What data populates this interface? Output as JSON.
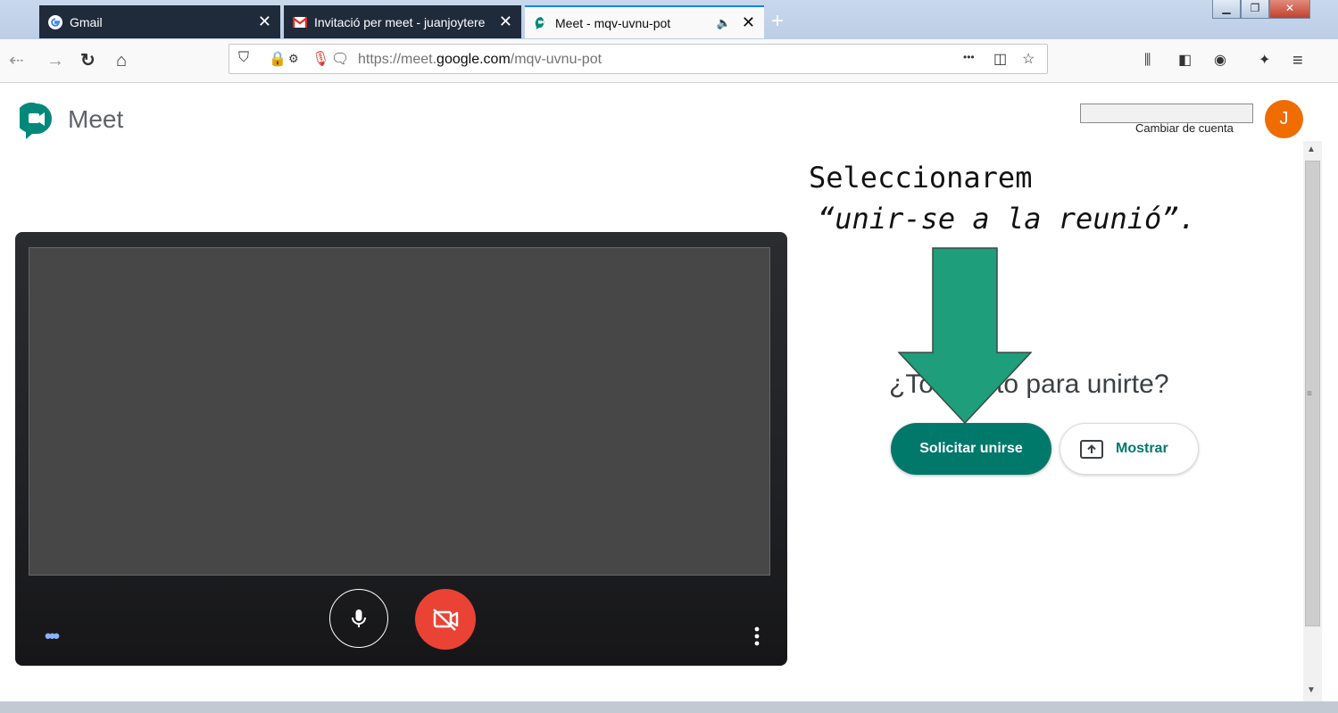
{
  "browser": {
    "tabs": [
      {
        "title": "Gmail",
        "close": "✕"
      },
      {
        "title": "Invitació per meet - juanjoytere",
        "close": "✕"
      },
      {
        "title": "Meet - mqv-uvnu-pot",
        "close": "✕",
        "audio": "🔈"
      }
    ],
    "new_tab": "+",
    "url_prefix": "https://meet.",
    "url_domain": "google.com",
    "url_path": "/mqv-uvnu-pot",
    "url_more": "•••"
  },
  "meet": {
    "brand": "Meet",
    "account_switch": "Cambiar de cuenta",
    "avatar_letter": "J",
    "ready_text": "¿Todo listo para unirte?",
    "join_button": "Solicitar unirse",
    "present_button": "Mostrar",
    "more_dots": "•••"
  },
  "annotation": {
    "line1": "Seleccionarem",
    "line2": "“unir-se a la reunió”."
  },
  "colors": {
    "join_teal": "#00796b",
    "arrow_green": "#1e9e7a",
    "cam_red": "#ea4335",
    "avatar_orange": "#ef6c00"
  }
}
